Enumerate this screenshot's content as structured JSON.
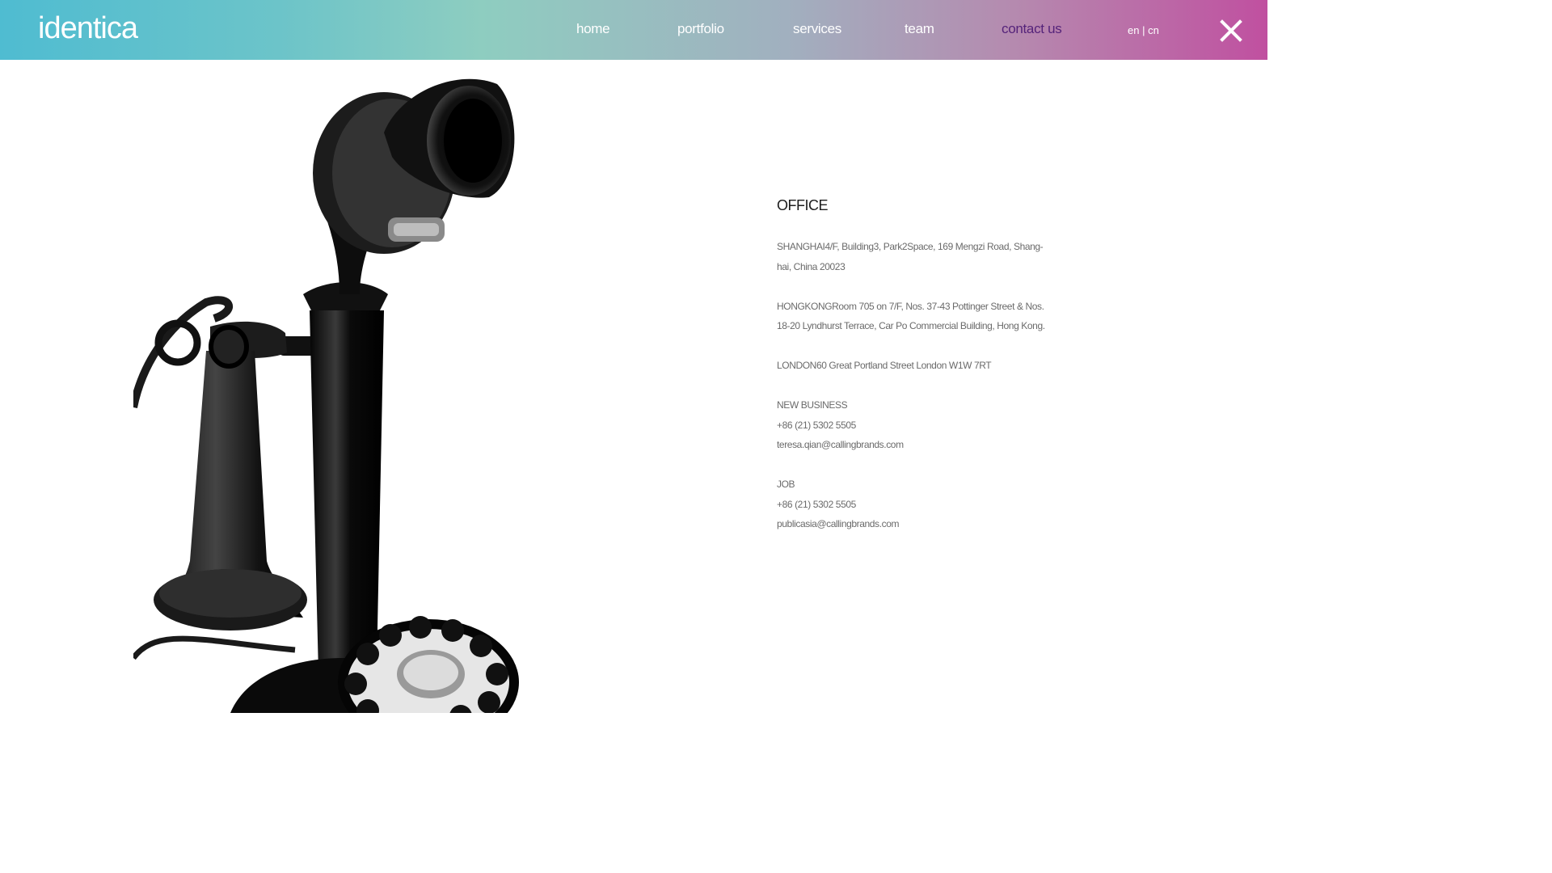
{
  "brand": {
    "logo": "identica"
  },
  "nav": {
    "items": [
      "home",
      "portfolio",
      "services",
      "team",
      "contact us"
    ],
    "active": "contact us",
    "active_color": "#55237a"
  },
  "lang": {
    "en": "en",
    "sep": "|",
    "cn": "cn"
  },
  "close": {
    "icon": "close-icon"
  },
  "header": {
    "gradient": [
      "#4fbcd1",
      "#8ecdc0",
      "#a1b0bf",
      "#c050a0"
    ]
  },
  "contact": {
    "heading": "OFFICE",
    "shanghai": {
      "line1": "SHANGHAI4/F, Building3, Park2Space, 169 Mengzi Road, Shang-",
      "line2": "hai, China 20023"
    },
    "hongkong": {
      "line1": "HONGKONGRoom 705 on 7/F, Nos. 37-43 Pottinger Street & Nos.",
      "line2": "18-20 Lyndhurst Terrace, Car Po Commercial Building, Hong Kong."
    },
    "london": "LONDON60 Great Portland Street London W1W 7RT",
    "new_business": {
      "title": "NEW BUSINESS",
      "phone": "+86 (21) 5302 5505",
      "email": "teresa.qian@callingbrands.com"
    },
    "job": {
      "title": "JOB",
      "phone": "+86 (21) 5302 5505",
      "email": "publicasia@callingbrands.com"
    }
  },
  "image": {
    "subject": "candlestick-telephone"
  }
}
